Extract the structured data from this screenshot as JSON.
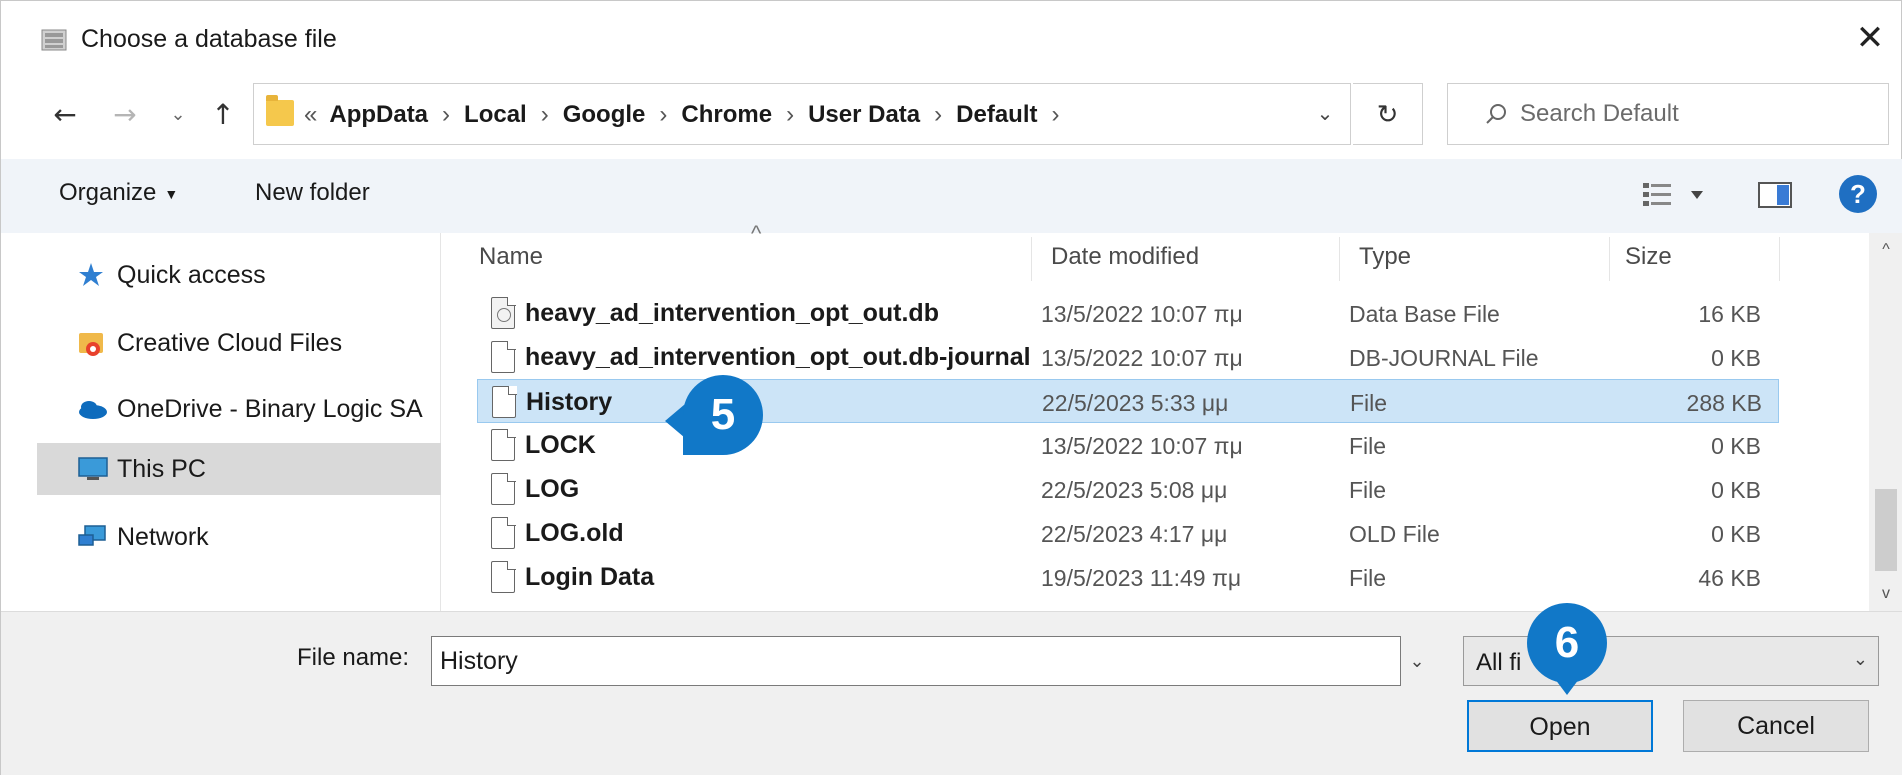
{
  "window": {
    "title": "Choose a database file",
    "close_symbol": "✕"
  },
  "nav": {
    "back_symbol": "←",
    "forward_symbol": "→",
    "recent_symbol": "⌄",
    "up_symbol": "↑",
    "overflow": "«",
    "breadcrumbs": [
      "AppData",
      "Local",
      "Google",
      "Chrome",
      "User Data",
      "Default"
    ],
    "separator": "›",
    "dropdown_symbol": "⌄",
    "refresh_symbol": "↻"
  },
  "search": {
    "placeholder": "Search Default"
  },
  "commands": {
    "organize": "Organize",
    "organize_caret": "▼",
    "new_folder": "New folder",
    "help_symbol": "?"
  },
  "navpane": {
    "items": [
      {
        "label": "Quick access",
        "icon": "star-icon"
      },
      {
        "label": "Creative Cloud Files",
        "icon": "creative-cloud-icon"
      },
      {
        "label": "OneDrive - Binary Logic SA",
        "icon": "onedrive-icon"
      },
      {
        "label": "This PC",
        "icon": "computer-icon",
        "selected": true
      },
      {
        "label": "Network",
        "icon": "network-icon"
      }
    ]
  },
  "filelist": {
    "columns": {
      "name": "Name",
      "date": "Date modified",
      "type": "Type",
      "size": "Size"
    },
    "sort_symbol": "^",
    "rows": [
      {
        "name": "heavy_ad_intervention_opt_out.db",
        "date": "13/5/2022 10:07 πμ",
        "type": "Data Base File",
        "size": "16 KB"
      },
      {
        "name": "heavy_ad_intervention_opt_out.db-journal",
        "date": "13/5/2022 10:07 πμ",
        "type": "DB-JOURNAL File",
        "size": "0 KB"
      },
      {
        "name": "History",
        "date": "22/5/2023 5:33 μμ",
        "type": "File",
        "size": "288 KB"
      },
      {
        "name": "LOCK",
        "date": "13/5/2022 10:07 πμ",
        "type": "File",
        "size": "0 KB"
      },
      {
        "name": "LOG",
        "date": "22/5/2023 5:08 μμ",
        "type": "File",
        "size": "0 KB"
      },
      {
        "name": "LOG.old",
        "date": "22/5/2023 4:17 μμ",
        "type": "OLD File",
        "size": "0 KB"
      },
      {
        "name": "Login Data",
        "date": "19/5/2023 11:49 πμ",
        "type": "File",
        "size": "46 KB"
      }
    ]
  },
  "scrollbar": {
    "up_symbol": "^",
    "down_symbol": "v"
  },
  "footer": {
    "file_name_label": "File name:",
    "file_name_value": "History",
    "dropdown_symbol": "⌄",
    "filter_value": "All fi",
    "open_label": "Open",
    "cancel_label": "Cancel"
  },
  "callouts": {
    "step5": "5",
    "step6": "6"
  },
  "colors": {
    "accent": "#1178c8",
    "selection": "#cce4f7",
    "help": "#1f6fc2"
  }
}
